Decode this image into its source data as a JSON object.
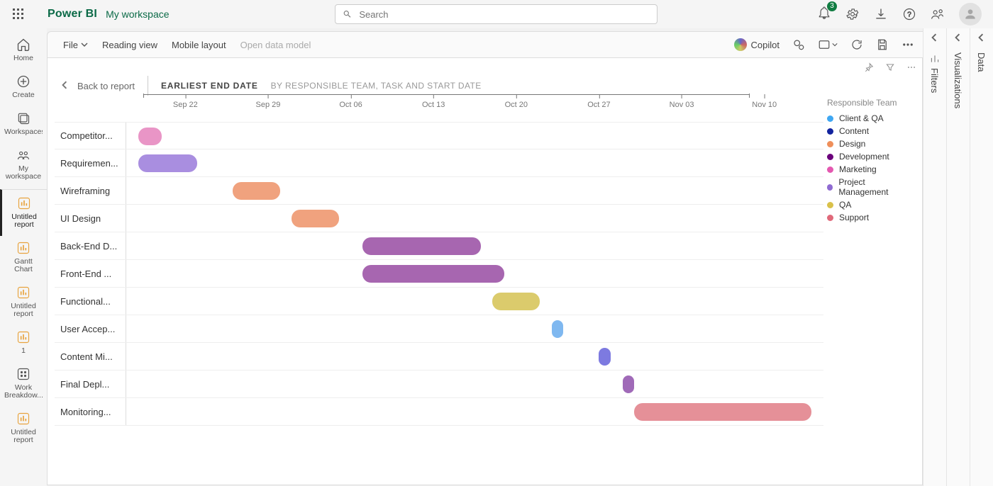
{
  "header": {
    "brand": "Power BI",
    "workspace": "My workspace",
    "search_placeholder": "Search",
    "notification_count": "3"
  },
  "nav": [
    {
      "id": "home",
      "label": "Home"
    },
    {
      "id": "create",
      "label": "Create"
    },
    {
      "id": "workspaces",
      "label": "Workspaces"
    },
    {
      "id": "myworkspace",
      "label": "My workspace"
    },
    {
      "id": "untitled-report",
      "label": "Untitled report",
      "sep": true,
      "active": true
    },
    {
      "id": "gantt-chart",
      "label": "Gantt Chart"
    },
    {
      "id": "untitled-report-2",
      "label": "Untitled report"
    },
    {
      "id": "one",
      "label": "1"
    },
    {
      "id": "wbs",
      "label": "Work Breakdow..."
    },
    {
      "id": "untitled-report-3",
      "label": "Untitled report"
    }
  ],
  "toolbar": {
    "file": "File",
    "reading": "Reading view",
    "mobile": "Mobile layout",
    "datamodel": "Open data model",
    "copilot": "Copilot"
  },
  "report": {
    "back": "Back to report",
    "title": "EARLIEST END DATE",
    "subtitle": "BY RESPONSIBLE TEAM, TASK AND START DATE"
  },
  "legend": {
    "title": "Responsible Team",
    "items": [
      {
        "name": "Client & QA",
        "color": "#3fa7f2"
      },
      {
        "name": "Content",
        "color": "#12239e"
      },
      {
        "name": "Design",
        "color": "#ef8f5a"
      },
      {
        "name": "Development",
        "color": "#6b007b"
      },
      {
        "name": "Marketing",
        "color": "#e458b0"
      },
      {
        "name": "Project Management",
        "color": "#8f6bd2"
      },
      {
        "name": "QA",
        "color": "#d9c14a"
      },
      {
        "name": "Support",
        "color": "#e0697a"
      }
    ]
  },
  "panes": {
    "filters": "Filters",
    "viz": "Visualizations",
    "data": "Data"
  },
  "chart_data": {
    "type": "bar",
    "orientation": "gantt",
    "title": "Earliest End Date by Responsible Team, Task and Start Date",
    "x_axis_dates": [
      "Sep 22",
      "Sep 29",
      "Oct 06",
      "Oct 13",
      "Oct 20",
      "Oct 27",
      "Nov 03",
      "Nov 10"
    ],
    "date_range": [
      "2024-09-17",
      "2024-11-15"
    ],
    "tasks": [
      {
        "task": "Competitor Analysis",
        "team": "Marketing",
        "start": "2024-09-18",
        "end": "2024-09-20",
        "color": "#e995c6"
      },
      {
        "task": "Requirement Gathering",
        "team": "Project Management",
        "start": "2024-09-18",
        "end": "2024-09-23",
        "color": "#a98ee0"
      },
      {
        "task": "Wireframing",
        "team": "Design",
        "start": "2024-09-26",
        "end": "2024-09-30",
        "color": "#f0a27e"
      },
      {
        "task": "UI Design",
        "team": "Design",
        "start": "2024-10-01",
        "end": "2024-10-05",
        "color": "#f0a27e"
      },
      {
        "task": "Back-End Development",
        "team": "Development",
        "start": "2024-10-07",
        "end": "2024-10-17",
        "color": "#a766b0"
      },
      {
        "task": "Front-End Development",
        "team": "Development",
        "start": "2024-10-07",
        "end": "2024-10-19",
        "color": "#a766b0"
      },
      {
        "task": "Functional Testing",
        "team": "QA",
        "start": "2024-10-18",
        "end": "2024-10-22",
        "color": "#dbcb6c"
      },
      {
        "task": "User Acceptance Testing",
        "team": "Client & QA",
        "start": "2024-10-23",
        "end": "2024-10-24",
        "color": "#7fb8f0"
      },
      {
        "task": "Content Migration",
        "team": "Content",
        "start": "2024-10-27",
        "end": "2024-10-28",
        "color": "#7d7ae0"
      },
      {
        "task": "Final Deployment",
        "team": "Development",
        "start": "2024-10-29",
        "end": "2024-10-30",
        "color": "#a06ab8"
      },
      {
        "task": "Monitoring & Support",
        "team": "Support",
        "start": "2024-10-30",
        "end": "2024-11-14",
        "color": "#e59098"
      }
    ]
  }
}
